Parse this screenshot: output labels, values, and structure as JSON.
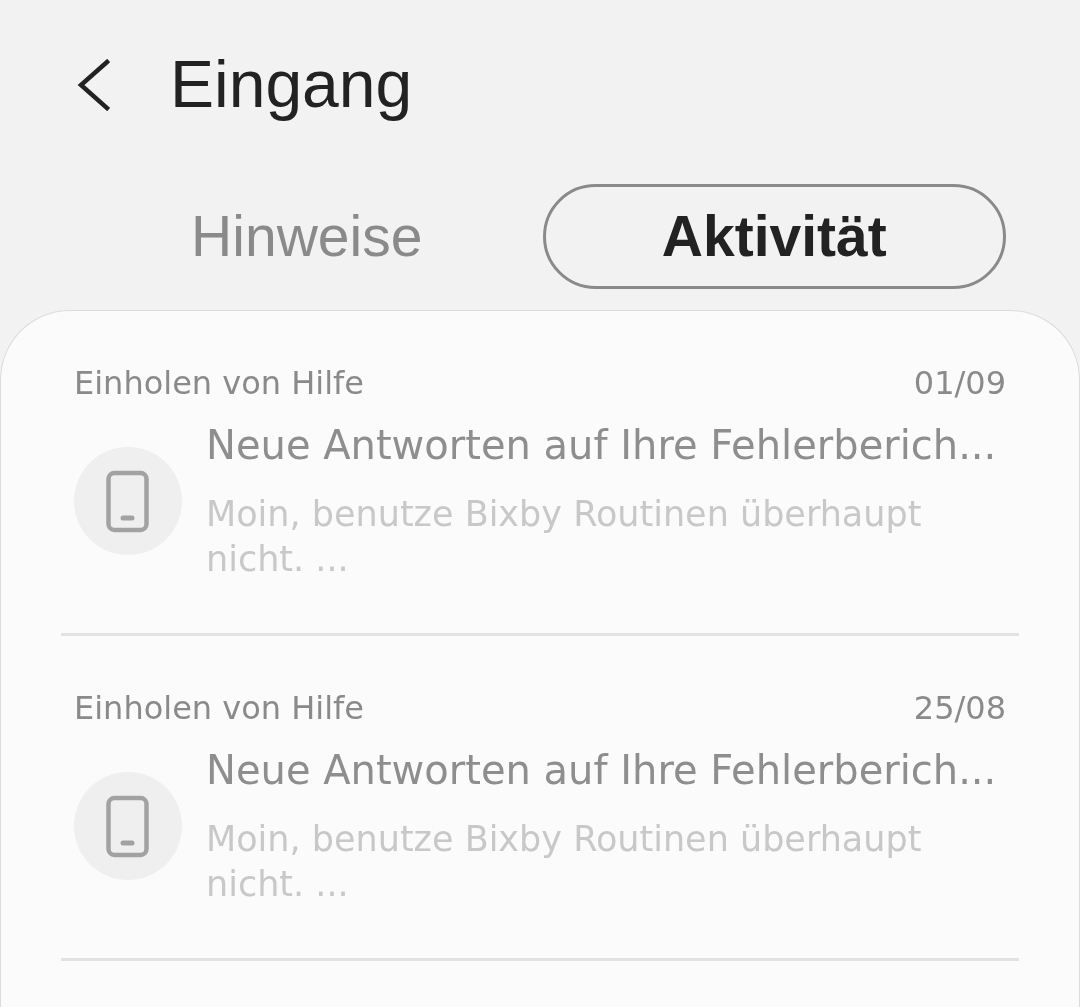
{
  "header": {
    "title": "Eingang"
  },
  "tabs": [
    {
      "label": "Hinweise",
      "selected": false
    },
    {
      "label": "Aktivität",
      "selected": true
    }
  ],
  "messages": [
    {
      "source": "Einholen von Hilfe",
      "date": "01/09",
      "title": "Neue Antworten auf Ihre Fehlerberich...",
      "preview": "Moin, benutze Bixby Routinen überhaupt nicht. ..."
    },
    {
      "source": "Einholen von Hilfe",
      "date": "25/08",
      "title": "Neue Antworten auf Ihre Fehlerberich...",
      "preview": "Moin, benutze Bixby Routinen überhaupt nicht. ..."
    }
  ]
}
